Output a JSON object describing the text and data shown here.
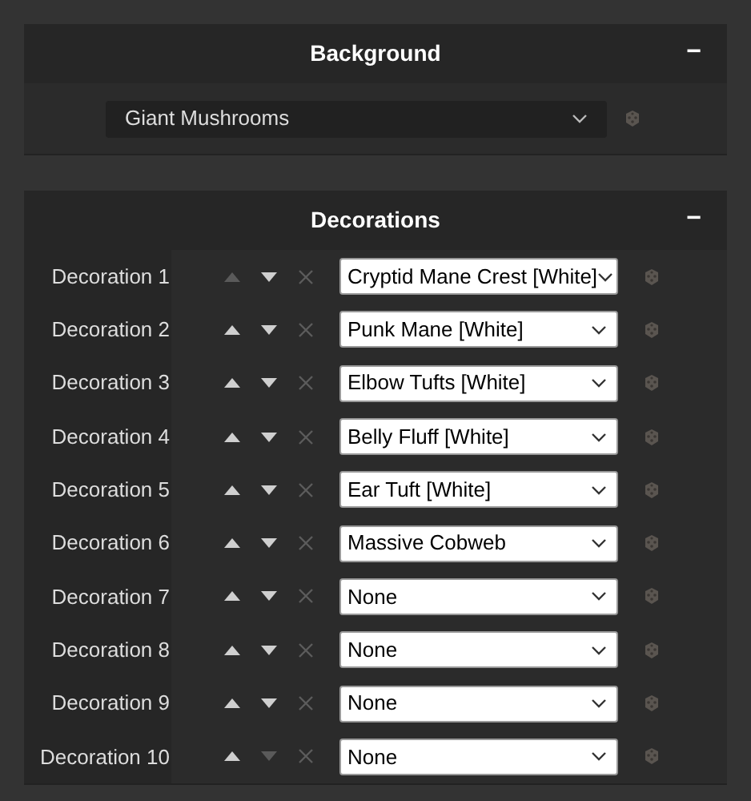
{
  "background": {
    "title": "Background",
    "collapse": "−",
    "select": {
      "value": "Giant Mushrooms"
    }
  },
  "decorations": {
    "title": "Decorations",
    "collapse": "−",
    "rows": [
      {
        "label": "Decoration 1",
        "value": "Cryptid Mane Crest [White]",
        "up_disabled": true,
        "down_disabled": false
      },
      {
        "label": "Decoration 2",
        "value": "Punk Mane [White]",
        "up_disabled": false,
        "down_disabled": false
      },
      {
        "label": "Decoration 3",
        "value": "Elbow Tufts [White]",
        "up_disabled": false,
        "down_disabled": false
      },
      {
        "label": "Decoration 4",
        "value": "Belly Fluff [White]",
        "up_disabled": false,
        "down_disabled": false
      },
      {
        "label": "Decoration 5",
        "value": "Ear Tuft [White]",
        "up_disabled": false,
        "down_disabled": false
      },
      {
        "label": "Decoration 6",
        "value": "Massive Cobweb",
        "up_disabled": false,
        "down_disabled": false
      },
      {
        "label": "Decoration 7",
        "value": "None",
        "up_disabled": false,
        "down_disabled": false
      },
      {
        "label": "Decoration 8",
        "value": "None",
        "up_disabled": false,
        "down_disabled": false
      },
      {
        "label": "Decoration 9",
        "value": "None",
        "up_disabled": false,
        "down_disabled": false
      },
      {
        "label": "Decoration 10",
        "value": "None",
        "up_disabled": false,
        "down_disabled": true
      }
    ]
  }
}
